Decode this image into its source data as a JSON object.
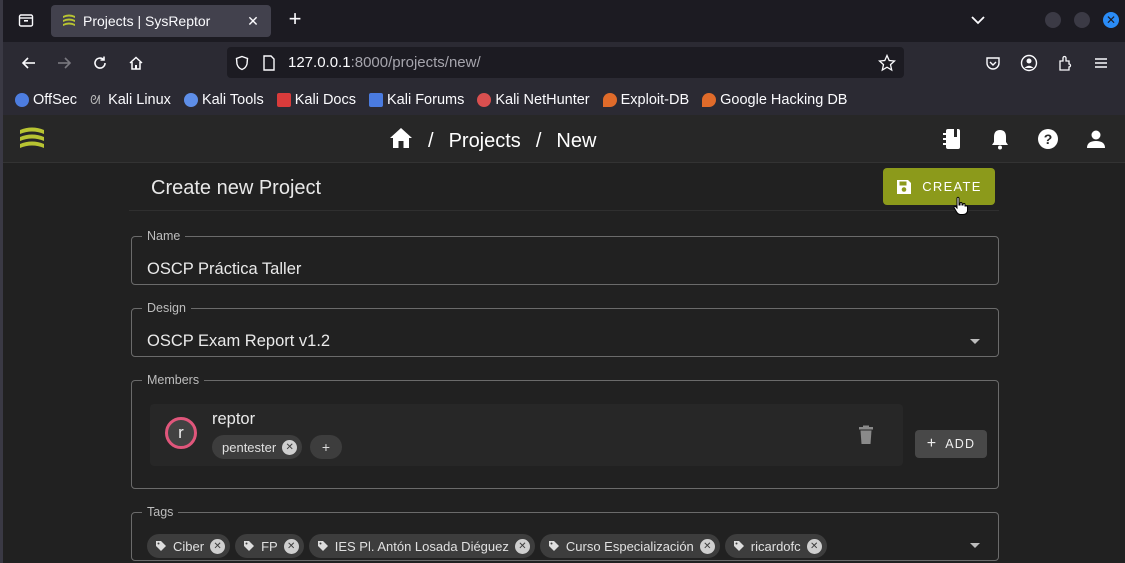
{
  "browser": {
    "tab_title": "Projects | SysReptor",
    "url_host": "127.0.0.1",
    "url_rest": ":8000/projects/new/",
    "bookmarks": [
      {
        "label": "OffSec",
        "color": "#4d7de0"
      },
      {
        "label": "Kali Linux",
        "color": "#9aa0a6"
      },
      {
        "label": "Kali Tools",
        "color": "#5e8ee8"
      },
      {
        "label": "Kali Docs",
        "color": "#d93b3b"
      },
      {
        "label": "Kali Forums",
        "color": "#4a7be0"
      },
      {
        "label": "Kali NetHunter",
        "color": "#d94f4f"
      },
      {
        "label": "Exploit-DB",
        "color": "#e06b2a"
      },
      {
        "label": "Google Hacking DB",
        "color": "#e06b2a"
      }
    ]
  },
  "appbar": {
    "breadcrumb_projects": "Projects",
    "breadcrumb_new": "New",
    "separator": "/"
  },
  "page": {
    "title": "Create new Project",
    "create_label": "CREATE"
  },
  "form": {
    "name_label": "Name",
    "name_value": "OSCP Práctica Taller",
    "design_label": "Design",
    "design_value": "OSCP Exam Report v1.2",
    "members_label": "Members",
    "member": {
      "initial": "r",
      "name": "reptor",
      "role": "pentester"
    },
    "add_label": "ADD",
    "tags_label": "Tags",
    "tags": [
      "Ciber",
      "FP",
      "IES Pl. Antón Losada Diéguez",
      "Curso Especialización",
      "ricardofc"
    ]
  },
  "colors": {
    "accent": "#8c9a1b",
    "avatar_ring": "#e0567b",
    "url_focus": "#2a8cf7"
  }
}
